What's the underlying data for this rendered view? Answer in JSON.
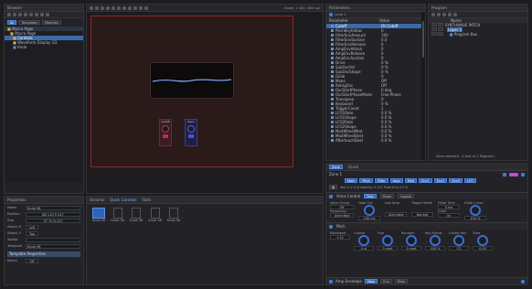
{
  "left_panel": {
    "title": "Browser",
    "tabs": [
      "All",
      "Templates",
      "Modules"
    ],
    "tree": [
      {
        "label": "Macro Page",
        "type": "page"
      },
      {
        "label": "Macro Page",
        "type": "folder"
      },
      {
        "label": "Controls",
        "type": "folder",
        "selected": true
      },
      {
        "label": "Waveform Display 1D",
        "type": "folder"
      },
      {
        "label": "Knob",
        "type": "item"
      }
    ]
  },
  "properties_panel": {
    "title": "Properties",
    "fields": [
      {
        "label": "Name",
        "value": "Knob 98"
      },
      {
        "label": "Position",
        "value": "88  110  9  247"
      },
      {
        "label": "Size",
        "value": "37  70  8  247"
      },
      {
        "label": "Attach H",
        "value": "Left"
      },
      {
        "label": "Attach V",
        "value": "Top"
      },
      {
        "label": "Tooltip",
        "value": ""
      },
      {
        "label": "Template",
        "value": "Knob 98"
      }
    ],
    "section": "Template Properties",
    "extra": {
      "label": "Macro",
      "value": "Off"
    }
  },
  "canvas": {
    "toolbar_right": "Zoom: 1   100, 4000 px",
    "knob_labels": [
      "Cutoff",
      "Reso"
    ]
  },
  "bottom_tabs": {
    "tabs": [
      "Variants",
      "Quick Controls",
      "Slots"
    ],
    "items": [
      "Knob 98",
      "Knob 98",
      "Knob 98",
      "Knob 98",
      "Knob 98"
    ]
  },
  "parameters_panel": {
    "title": "Parameters",
    "tab": "Level 1",
    "columns": [
      "Parameter",
      "Value"
    ],
    "rows": [
      {
        "name": "Cutoff",
        "value": "Flt Cutoff",
        "selected": true
      },
      {
        "name": "PitchKeyfollow",
        "value": "0"
      },
      {
        "name": "FilterEnvAmount",
        "value": "100"
      },
      {
        "name": "FilterEnvSustain",
        "value": "0.0"
      },
      {
        "name": "FilterEnvRelease",
        "value": "0"
      },
      {
        "name": "AmpEnvAttack",
        "value": "0"
      },
      {
        "name": "AmpEnvRelease",
        "value": "0"
      },
      {
        "name": "AmpEnvSustain",
        "value": "0"
      },
      {
        "name": "Drive",
        "value": "0 %"
      },
      {
        "name": "SubOscVol",
        "value": "0 %"
      },
      {
        "name": "SubOscShape",
        "value": "0 %"
      },
      {
        "name": "Glide",
        "value": "0"
      },
      {
        "name": "Mono",
        "value": "Off"
      },
      {
        "name": "RetrigOsc",
        "value": "Off"
      },
      {
        "name": "OscStartPhase",
        "value": "0 deg"
      },
      {
        "name": "OscStartPhaseMode",
        "value": "Free Phase"
      },
      {
        "name": "Transpose",
        "value": "0"
      },
      {
        "name": "Keyboard",
        "value": "0 %"
      },
      {
        "name": "TriggerCount",
        "value": "1"
      },
      {
        "name": "LFO1Rate",
        "value": "0.0 %"
      },
      {
        "name": "LFO1Shape",
        "value": "0.0 %"
      },
      {
        "name": "LFO2Rate",
        "value": "0.0 %"
      },
      {
        "name": "LFO2Shape",
        "value": "0.0 %"
      },
      {
        "name": "ModWheelMod",
        "value": "0.0 %"
      },
      {
        "name": "ModWheelDest",
        "value": "0.0 %"
      },
      {
        "name": "AftertouchDest",
        "value": "0.0 %"
      }
    ]
  },
  "program_panel": {
    "title": "Program",
    "columns": [
      "Name"
    ],
    "rows": [
      {
        "label": "SYNTHWAVE PATCH",
        "level": 0
      },
      {
        "label": "Layer 1",
        "level": 1,
        "selected": true
      },
      {
        "label": "Program Bus",
        "level": 2
      }
    ],
    "status": "Zone selected - 0 (out of 1 Program)"
  },
  "zone_panel": {
    "tabs": [
      "Zone",
      "Quick"
    ],
    "zone_name": "Zone 1",
    "buttons": [
      "Main",
      "Pitch",
      "Filter",
      "Amp",
      "Mod",
      "Env1",
      "Env2",
      "Env3",
      "LFO"
    ],
    "note_row": "Key  C-2  G 8  Velocity  0  127  Fade Env  0  0  0",
    "sections": [
      {
        "title": "Voice Control",
        "tabs": [
          "Poly",
          "Mono",
          "Legato"
        ],
        "fields": [
          {
            "label": "Voice Group",
            "value": "Off"
          },
          {
            "label": "Polyphony",
            "value": "Unlimited"
          },
          {
            "label": "Fade Out",
            "value": "100 ms"
          },
          {
            "label": "Low Amp",
            "value": "Unlimited"
          },
          {
            "label": "Trigger Mode",
            "value": "Normal"
          },
          {
            "label": "Glide Time",
            "value": "0 ms"
          },
          {
            "label": "Glide",
            "value": "On"
          },
          {
            "label": "Glide Curve",
            "value": "100 %"
          }
        ]
      },
      {
        "title": "Pitch",
        "fields": [
          {
            "label": "Pitchbend",
            "value": "+12"
          },
          {
            "label": "Coarse",
            "value": "0 st"
          },
          {
            "label": "Fine",
            "value": "0 cent"
          },
          {
            "label": "Random",
            "value": "0 cent"
          },
          {
            "label": "Key Follow",
            "value": "100 %"
          },
          {
            "label": "Center Key",
            "value": "C3"
          },
          {
            "label": "Tune",
            "value": "0.00"
          }
        ]
      }
    ],
    "bottom_tabs": [
      "Main",
      "Env",
      "Filter"
    ],
    "bottom_title": "Amp Envelope"
  }
}
